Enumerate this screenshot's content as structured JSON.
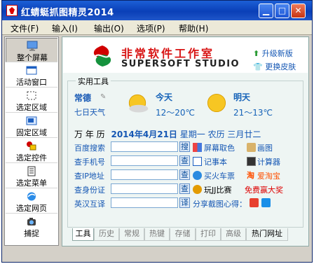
{
  "window": {
    "title": "红蜻蜓抓图精灵2014"
  },
  "titlebar": {
    "minimize": "▁",
    "maximize": "□",
    "close": "✕"
  },
  "menu": [
    {
      "label": "文件(F)"
    },
    {
      "label": "输入(I)"
    },
    {
      "label": "输出(O)"
    },
    {
      "label": "选项(P)"
    },
    {
      "label": "帮助(H)"
    }
  ],
  "sidebar": {
    "items": [
      {
        "label": "整个屏幕",
        "icon": "monitor-icon"
      },
      {
        "label": "活动窗口",
        "icon": "window-icon"
      },
      {
        "label": "选定区域",
        "icon": "select-region-icon"
      },
      {
        "label": "固定区域",
        "icon": "fixed-region-icon"
      },
      {
        "label": "选定控件",
        "icon": "control-icon"
      },
      {
        "label": "选定菜单",
        "icon": "menu-icon"
      },
      {
        "label": "选定网页",
        "icon": "web-icon"
      },
      {
        "label": "捕捉",
        "icon": "camera-icon"
      }
    ]
  },
  "brand": {
    "name_cn": "非常软件工作室",
    "name_en": "SUPERSOFT STUDIO",
    "upgrade": "升级新版",
    "skin": "更换皮肤"
  },
  "tools_title": "实用工具",
  "weather": {
    "city": "常德",
    "link": "七日天气",
    "today_label": "今天",
    "today_temp": "12～20℃",
    "tomorrow_label": "明天",
    "tomorrow_temp": "21～13℃"
  },
  "calendar": {
    "label": "万 年 历",
    "date": "2014年4月21日",
    "weekday": "星期一",
    "lunar": "农历 三月廿二"
  },
  "rows": [
    {
      "label": "百度搜索",
      "button": "搜",
      "placeholder": ""
    },
    {
      "label": "查手机号",
      "button": "查",
      "placeholder": ""
    },
    {
      "label": "查IP地址",
      "button": "查",
      "placeholder": ""
    },
    {
      "label": "查身份证",
      "button": "查",
      "placeholder": ""
    },
    {
      "label": "英汉互译",
      "button": "译",
      "placeholder": ""
    }
  ],
  "right_tools": [
    {
      "label": "屏幕取色",
      "label2": "画图"
    },
    {
      "label": "记事本",
      "label2": "计算器"
    },
    {
      "label": "买火车票",
      "label2": "爱淘宝"
    },
    {
      "label": "玩JJ比赛",
      "label2": "免费赢大奖"
    }
  ],
  "share_text": "分享截图心得：",
  "tabs": [
    "工具",
    "历史",
    "常规",
    "热键",
    "存储",
    "打印",
    "高级",
    "热门网址"
  ]
}
